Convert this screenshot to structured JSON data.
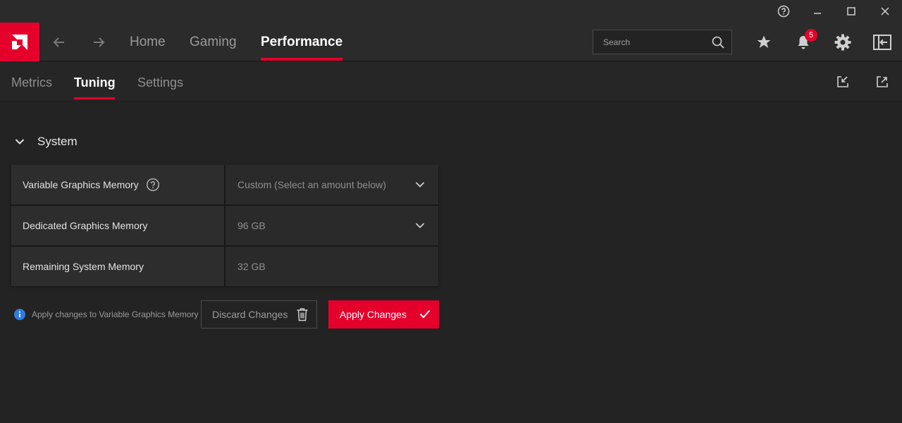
{
  "window": {
    "controls": [
      {
        "name": "help",
        "icon": "question-circle-icon"
      },
      {
        "name": "minimize",
        "icon": "minimize-icon"
      },
      {
        "name": "maximize",
        "icon": "maximize-icon"
      },
      {
        "name": "close",
        "icon": "close-icon"
      }
    ]
  },
  "topnav": {
    "logo_icon": "amd-logo-icon",
    "tabs": [
      {
        "label": "Home"
      },
      {
        "label": "Gaming"
      },
      {
        "label": "Performance",
        "active": true
      }
    ],
    "search": {
      "placeholder": "Search"
    },
    "notifications_count": "5",
    "accent_color": "#e4002b"
  },
  "subnav": {
    "tabs": [
      {
        "label": "Metrics"
      },
      {
        "label": "Tuning",
        "active": true
      },
      {
        "label": "Settings"
      }
    ]
  },
  "section": {
    "title": "System",
    "rows": [
      {
        "label": "Variable Graphics Memory",
        "value": "Custom (Select an amount below)",
        "has_help": true,
        "dropdown": true
      },
      {
        "label": "Dedicated Graphics Memory",
        "value": "96 GB",
        "dropdown": true
      },
      {
        "label": "Remaining System Memory",
        "value": "32 GB",
        "dropdown": false
      }
    ]
  },
  "actions": {
    "info_text": "Apply changes to Variable Graphics Memory",
    "discard_label": "Discard Changes",
    "apply_label": "Apply Changes"
  }
}
